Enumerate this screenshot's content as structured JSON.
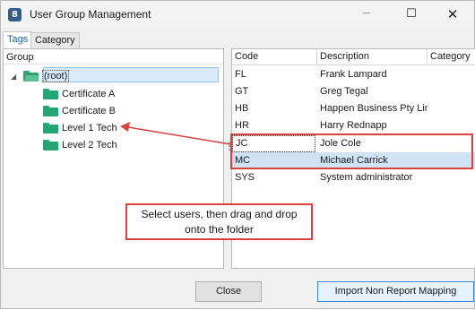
{
  "window": {
    "title": "User Group Management",
    "app_icon_glyph": "8",
    "controls": {
      "minimize": "─",
      "maximize": "☐",
      "close": "✕"
    }
  },
  "tabs": [
    {
      "label": "Tags",
      "active": true
    },
    {
      "label": "Category",
      "active": false
    }
  ],
  "group_panel": {
    "header": "Group",
    "root": {
      "label": "(root)",
      "expand_glyph": "◢",
      "selected": true
    },
    "children": [
      "Certificate A",
      "Certificate B",
      "Level 1 Tech",
      "Level 2 Tech"
    ]
  },
  "splitter_glyph": "⋮",
  "user_grid": {
    "columns": [
      "Code",
      "Description",
      "Category"
    ],
    "rows": [
      {
        "code": "FL",
        "description": "Frank Lampard",
        "category": "",
        "selected": false
      },
      {
        "code": "GT",
        "description": "Greg Tegal",
        "category": "",
        "selected": false
      },
      {
        "code": "HB",
        "description": "Happen Business Pty Limi",
        "category": "",
        "selected": false
      },
      {
        "code": "HR",
        "description": "Harry Rednapp",
        "category": "",
        "selected": false
      },
      {
        "code": "JC",
        "description": "Jole Cole",
        "category": "",
        "selected": false
      },
      {
        "code": "MC",
        "description": "Michael Carrick",
        "category": "",
        "selected": true
      },
      {
        "code": "SYS",
        "description": "System administrator",
        "category": "",
        "selected": false
      }
    ]
  },
  "callout": {
    "line1": "Select users, then drag and drop",
    "line2": "onto the folder"
  },
  "buttons": {
    "close": "Close",
    "import": "Import Non Report Mapping"
  },
  "colors": {
    "annotation": "#d94040",
    "folder": "#23a574",
    "selection": "#cfe3f5"
  }
}
